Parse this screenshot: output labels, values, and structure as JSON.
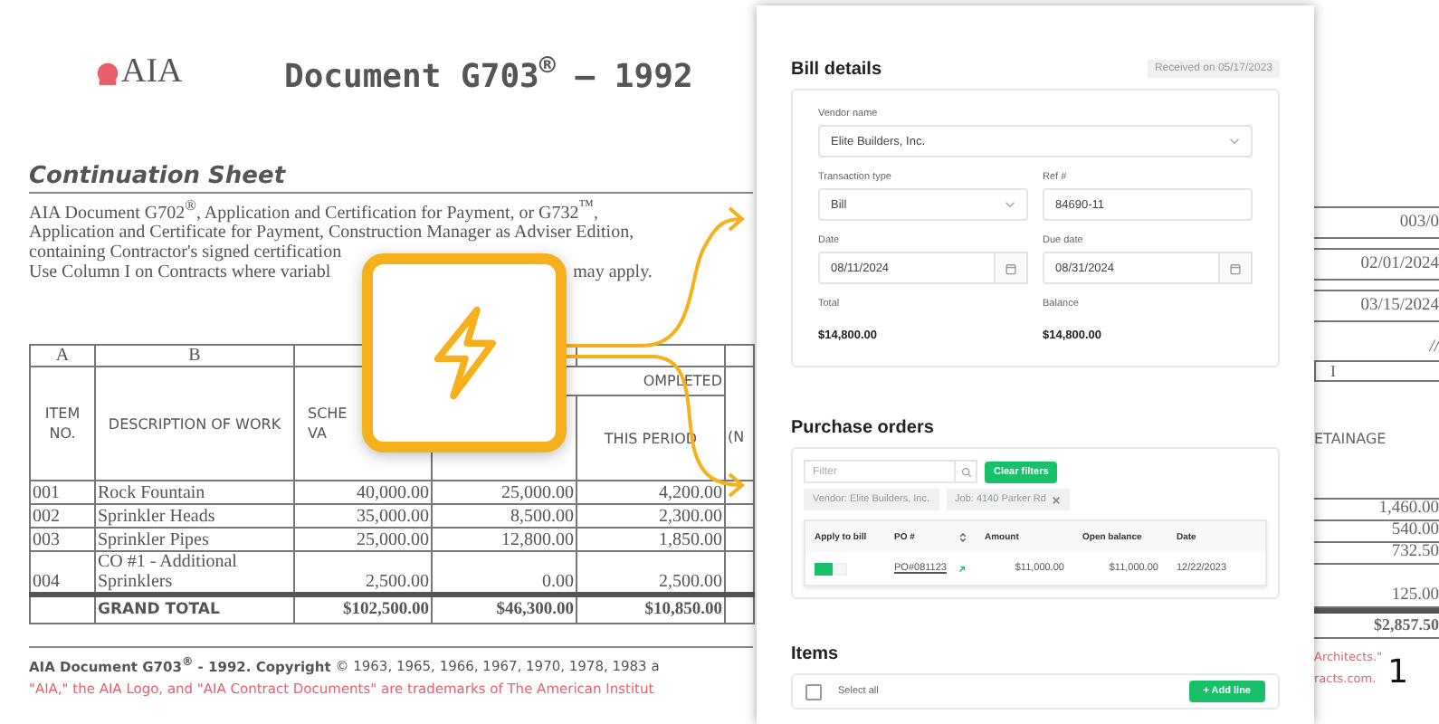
{
  "document": {
    "logo": "AIA",
    "title": "Document G703$^{®}$ — 1992",
    "heading": "Continuation Sheet",
    "intro_lines": [
      "AIA Document G702$^{®}$, Application and Certification for Payment, or G732$^{™}$,",
      "Application and Certificate for Payment, Construction Manager as Adviser Edition,",
      "containing Contractor's signed certification"
    ],
    "intro_last": [
      "Use Column I on Contracts where variabl",
      "may apply."
    ],
    "column_letters": {
      "a": "A",
      "b": "B"
    },
    "headers": {
      "item": "ITEM NO.",
      "description": "DESCRIPTION OF WORK",
      "scheduled": [
        "SCHE",
        "VA"
      ],
      "completed": "OMPLETED",
      "this_period": "THIS PERIOD",
      "next": "(N"
    },
    "rows": [
      {
        "item": "001",
        "description": "Rock Fountain",
        "scheduled": "40,000.00",
        "previous": "25,000.00",
        "this_period": "4,200.00"
      },
      {
        "item": "002",
        "description": "Sprinkler Heads",
        "scheduled": "35,000.00",
        "previous": "8,500.00",
        "this_period": "2,300.00"
      },
      {
        "item": "003",
        "description": "Sprinkler Pipes",
        "scheduled": "25,000.00",
        "previous": "12,800.00",
        "this_period": "1,850.00"
      },
      {
        "item": "004",
        "description": "CO #1 - Additional Sprinklers",
        "scheduled": "2,500.00",
        "previous": "0.00",
        "this_period": "2,500.00"
      }
    ],
    "grand_total": {
      "label": "GRAND TOTAL",
      "scheduled": "$102,500.00",
      "previous": "$46,300.00",
      "this_period": "$10,850.00"
    },
    "footer": "**AIA Document G703$^{®}$ - 1992. Copyright** © 1963, 1965, 1966, 1967, 1970, 1978, 1983 a",
    "trademark": "\"AIA,\" the AIA Logo, and \"AIA Contract Documents\" are trademarks of The American Institut"
  },
  "right_strip": {
    "info": [
      "003/0",
      "02/01/2024",
      "03/15/2024"
    ],
    "slash": "//",
    "letter": "I",
    "header": "ETAINAGE",
    "values": [
      "1,460.00",
      "540.00",
      "732.50",
      "125.00"
    ],
    "total": "$2,857.50",
    "trademark_lines": [
      "Architects.\"",
      "racts.com."
    ],
    "page_number": "1"
  },
  "app": {
    "bill": {
      "title": "Bill details",
      "received": "Received on 05/17/2023",
      "vendor": {
        "label": "Vendor name",
        "value": "Elite Builders, Inc."
      },
      "transaction_type": {
        "label": "Transaction type",
        "value": "Bill"
      },
      "ref": {
        "label": "Ref #",
        "value": "84690-11"
      },
      "date": {
        "label": "Date",
        "value": "08/11/2024"
      },
      "due_date": {
        "label": "Due date",
        "value": "08/31/2024"
      },
      "total": {
        "label": "Total",
        "value": "$14,800.00"
      },
      "balance": {
        "label": "Balance",
        "value": "$14,800.00"
      }
    },
    "purchase_orders": {
      "title": "Purchase orders",
      "filter_placeholder": "Filter",
      "clear_button": "Clear filters",
      "chips": [
        {
          "label": "Vendor: Elite Builders, Inc.",
          "removable": false
        },
        {
          "label": "Job: 4140 Parker Rd",
          "removable": true
        }
      ],
      "columns": [
        "Apply to bill",
        "PO #",
        "Amount",
        "Open balance",
        "Date"
      ],
      "rows": [
        {
          "apply": true,
          "po": "PO#081123",
          "amount": "$11,000.00",
          "open_balance": "$11,000.00",
          "date": "12/22/2023"
        }
      ]
    },
    "items": {
      "title": "Items",
      "select_all": {
        "label": "Select all",
        "checked": false
      },
      "add_button": "+ Add line"
    }
  }
}
